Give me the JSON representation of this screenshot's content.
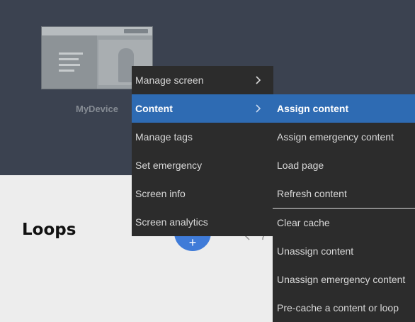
{
  "device": {
    "name": "MyDevice"
  },
  "page": {
    "title": "Loops"
  },
  "context_menu": {
    "items": [
      {
        "label": "Manage screen",
        "has_submenu": true
      },
      {
        "label": "Content",
        "has_submenu": true,
        "active": true
      },
      {
        "label": "Manage tags"
      },
      {
        "label": "Set emergency"
      },
      {
        "label": "Screen info"
      },
      {
        "label": "Screen analytics"
      }
    ]
  },
  "content_submenu": {
    "items": [
      {
        "label": "Assign content",
        "active": true
      },
      {
        "label": "Assign emergency content"
      },
      {
        "label": "Load page"
      },
      {
        "label": "Refresh content"
      },
      {
        "label": "Clear cache"
      },
      {
        "label": "Unassign content"
      },
      {
        "label": "Unassign emergency content"
      },
      {
        "label": "Pre-cache a content or loop"
      }
    ]
  },
  "toolbar": {
    "add_label": "+"
  },
  "icons": {
    "chevron": "chevron-right-icon",
    "search": "search-icon",
    "refresh": "refresh-icon"
  },
  "colors": {
    "header_bg": "#3b4250",
    "menu_bg": "#2c2c2c",
    "highlight": "#2e6bb3",
    "add_button": "#3f7bd8"
  }
}
